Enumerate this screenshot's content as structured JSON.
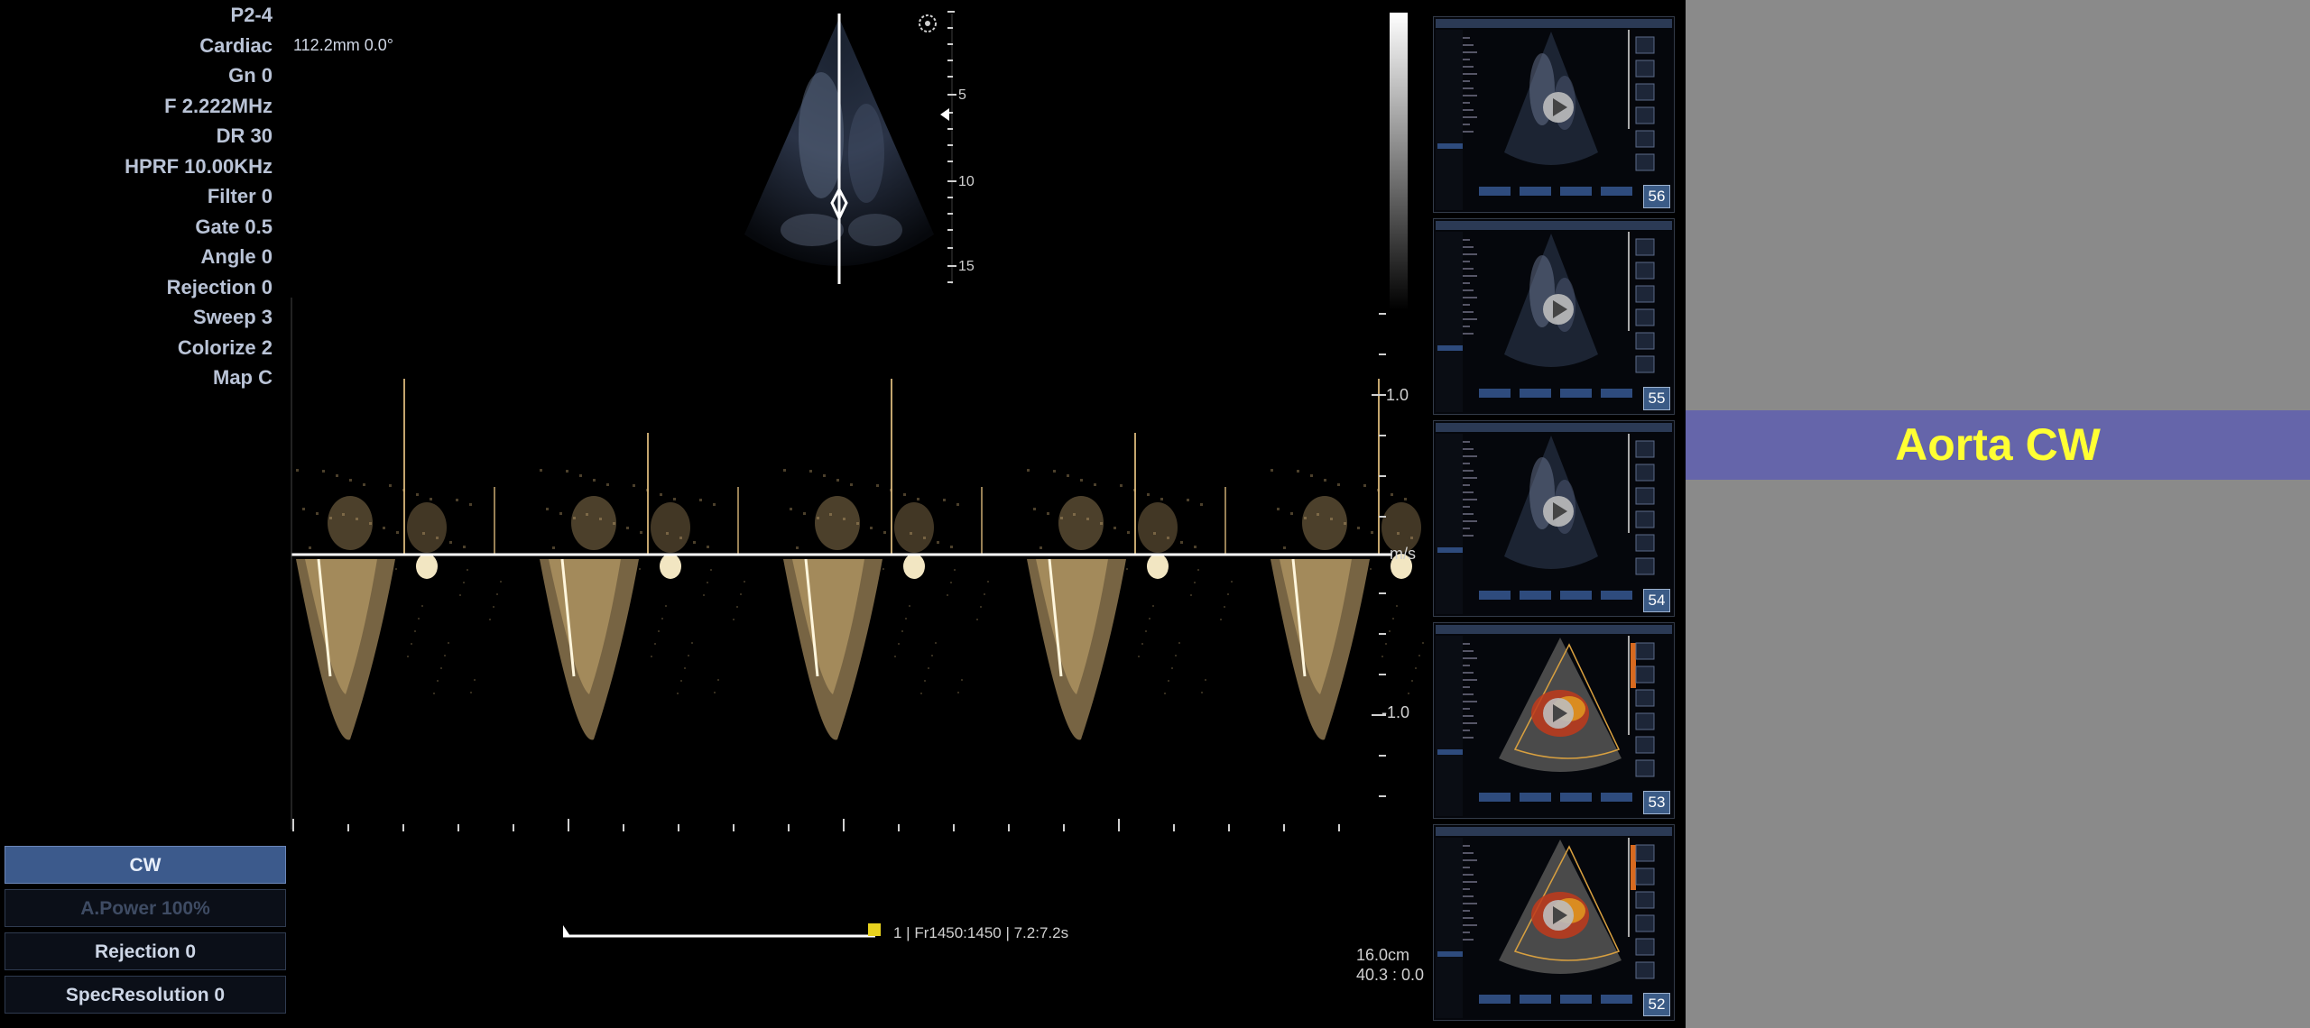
{
  "parameters": [
    "P2-4",
    "Cardiac",
    "Gn 0",
    "F 2.222MHz",
    "DR 30",
    "HPRF 10.00KHz",
    "Filter 0",
    "Gate 0.5",
    "Angle 0",
    "Rejection 0",
    "Sweep 3",
    "Colorize 2",
    "Map C"
  ],
  "measurement": "112.2mm  0.0°",
  "depth_scale": {
    "labels": [
      "5",
      "10",
      "15"
    ]
  },
  "velocity_scale": {
    "pos": "1.0",
    "neg": "-1.0",
    "unit": "m/s"
  },
  "cine_info": "1 | Fr1450:1450 | 7.2:7.2s",
  "depth_info": {
    "line1": "16.0cm",
    "line2": "40.3 : 0.0"
  },
  "mode_buttons": [
    {
      "label": "CW",
      "state": "active"
    },
    {
      "label": "A.Power 100%",
      "state": "disabled"
    },
    {
      "label": "Rejection  0",
      "state": "normal"
    },
    {
      "label": "SpecResolution  0",
      "state": "normal"
    }
  ],
  "thumbnails": [
    {
      "number": "56",
      "type": "bmode"
    },
    {
      "number": "55",
      "type": "bmode"
    },
    {
      "number": "54",
      "type": "bmode"
    },
    {
      "number": "53",
      "type": "color"
    },
    {
      "number": "52",
      "type": "color"
    }
  ],
  "title": "Aorta CW",
  "colors": {
    "doppler": "#d9b77a",
    "banner_bg": "#6565aa",
    "banner_text": "#ffff33",
    "panel_gray": "#8a8a8a"
  }
}
